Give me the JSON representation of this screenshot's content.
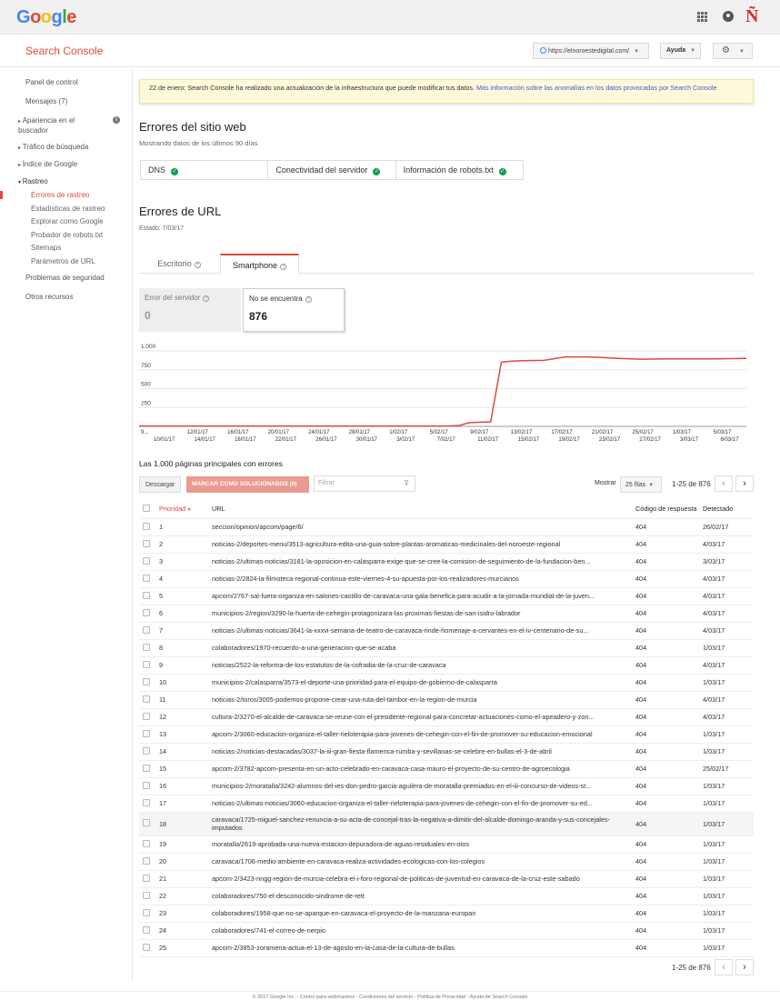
{
  "topbar": {
    "logo": "Google",
    "brand_mark": "Ñ"
  },
  "header": {
    "title": "Search Console",
    "site": "https://elnoroestedigital.com/",
    "help": "Ayuda"
  },
  "sidebar": {
    "panel": "Panel de control",
    "messages": "Mensajes (7)",
    "appearance": "Apariencia en el buscador",
    "traffic": "Tráfico de búsqueda",
    "index": "Índice de Google",
    "crawl": "Rastreo",
    "crawl_items": [
      "Errores de rastreo",
      "Estadísticas de rastreo",
      "Explorar como Google",
      "Probador de robots.txt",
      "Sitemaps",
      "Parámetros de URL"
    ],
    "security": "Problemas de seguridad",
    "other": "Otros recursos"
  },
  "notice": {
    "text": "22 de enero: Search Console ha realizado una actualización de la infraestructura que puede modificar tus datos. ",
    "link": "Más información sobre las anomalías en los datos provocadas por Search Console"
  },
  "site_errors": {
    "title": "Errores del sitio web",
    "subtitle": "Mostrando datos de los últimos 90 días",
    "items": [
      "DNS",
      "Conectividad del servidor",
      "Información de robots.txt"
    ]
  },
  "url_errors": {
    "title": "Errores de URL",
    "state": "Estado: 7/03/17",
    "tabs": [
      "Escritorio",
      "Smartphone"
    ],
    "stats": [
      {
        "label": "Error del servidor",
        "value": "0"
      },
      {
        "label": "No se encuentra",
        "value": "876"
      }
    ]
  },
  "chart_data": {
    "type": "line",
    "title": "",
    "ylabel": "",
    "xlabel": "",
    "ylim": [
      0,
      1000
    ],
    "yticks": [
      "1.000",
      "750",
      "500",
      "250"
    ],
    "xticks_top": [
      "9...",
      "12/01/17",
      "16/01/17",
      "20/01/17",
      "24/01/17",
      "28/01/17",
      "1/02/17",
      "5/02/17",
      "9/02/17",
      "13/02/17",
      "17/02/17",
      "21/02/17",
      "25/02/17",
      "1/03/17",
      "5/03/17"
    ],
    "xticks_bottom": [
      "10/01/17",
      "14/01/17",
      "18/01/17",
      "22/01/17",
      "26/01/17",
      "30/01/17",
      "3/02/17",
      "7/02/17",
      "11/02/17",
      "15/02/17",
      "19/02/17",
      "23/02/17",
      "27/02/17",
      "3/03/17",
      "6/03/17"
    ],
    "color": "#dd4b39",
    "series": [
      {
        "x": [
          0,
          29,
          30,
          31,
          33,
          34,
          35,
          36,
          38,
          40,
          42,
          43,
          45,
          47,
          50,
          52,
          54,
          57
        ],
        "y": [
          5,
          5,
          10,
          50,
          60,
          850,
          865,
          870,
          875,
          920,
          920,
          915,
          900,
          890,
          895,
          895,
          895,
          900
        ]
      }
    ]
  },
  "table_section": {
    "caption": "Las 1.000 páginas principales con errores",
    "download": "Descargar",
    "mark_fixed": "MARCAR COMO SOLUCIONADOS (0)",
    "filter_placeholder": "Filtrar",
    "show": "Mostrar",
    "rows_per_page": "25 filas",
    "range": "1-25 de 876",
    "columns": [
      "Prioridad",
      "URL",
      "Código de respuesta",
      "Detectado"
    ]
  },
  "rows": [
    [
      "1",
      "seccion/opinion/apcom/page/6/",
      "404",
      "26/02/17"
    ],
    [
      "2",
      "noticias-2/deportes-menu/3513-agricultura-edita-una-guia-sobre-plantas-aromaticas-medicinales-del-noroeste-regional",
      "404",
      "4/03/17"
    ],
    [
      "3",
      "noticias-2/ultimas-noticias/3181-la-oposicion-en-calasparra-exige-que-se-cree-la-comision-de-seguimiento-de-la-fundacion-ben...",
      "404",
      "3/03/17"
    ],
    [
      "4",
      "noticias-2/2824-la-filmoteca-regional-continua-este-viernes-4-su-apuesta-por-los-realizadores-murcianos",
      "404",
      "4/03/17"
    ],
    [
      "5",
      "apcom/2767-sal-fuera-organiza-en-salones-castillo-de-caravaca-una-gala-benefica-para-acudir-a-la-jornada-mundial-de-la-juven...",
      "404",
      "4/03/17"
    ],
    [
      "6",
      "municipios-2/region/3290-la-huerta-de-cehegin-protagonizara-las-proximas-fiestas-de-san-isidro-labrador",
      "404",
      "4/03/17"
    ],
    [
      "7",
      "noticias-2/ultimas-noticias/3641-la-xxxvi-semana-de-teatro-de-caravaca-rinde-homenaje-a-cervantes-en-el-iv-centenario-de-su...",
      "404",
      "4/03/17"
    ],
    [
      "8",
      "colaboradores/1970-recuerdo-a-una-generacion-que-se-acaba",
      "404",
      "1/03/17"
    ],
    [
      "9",
      "noticias/2522-la-reforma-de-los-estatutos-de-la-cofradia-de-la-cruz-de-caravaca",
      "404",
      "4/03/17"
    ],
    [
      "10",
      "municipios-2/calasparra/3573-el-deporte-una-prioridad-para-el-equipo-de-gobierno-de-calasparra",
      "404",
      "1/03/17"
    ],
    [
      "11",
      "noticias-2/toros/3005-podemos-propone-crear-una-ruta-del-tambor-en-la-region-de-murcia",
      "404",
      "4/03/17"
    ],
    [
      "12",
      "cultura-2/3270-el-alcalde-de-caravaca-se-reune-con-el-presidente-regional-para-concretar-actuaciones-como-el-apeadero-y-zon...",
      "404",
      "4/03/17"
    ],
    [
      "13",
      "apcom-2/3060-educacion-organiza-el-taller-rieloterapia-para-jovenes-de-cehegin-con-el-fin-de-promover-su-educacion-emocional",
      "404",
      "1/03/17"
    ],
    [
      "14",
      "noticias-2/noticias-destacadas/3037-la-iii-gran-fiesta-flamenca-rumba-y-sevillanas-se-celebre-en-bullas-el-3-de-abril",
      "404",
      "1/03/17"
    ],
    [
      "15",
      "apcom-2/3782-apcom-presenta-en-un-acto-celebrado-en-caravaca-casa-mauro-el-proyecto-de-su-centro-de-agroecologia",
      "404",
      "25/02/17"
    ],
    [
      "16",
      "municipios-2/moratalla/3242-alumnos-del-ies-don-pedro-garcia-aguilera-de-moratalla-premiados-en-el-iii-concurso-de-videos-st...",
      "404",
      "1/03/17"
    ],
    [
      "17",
      "noticias-2/ultimas-noticias/3060-educacion-organiza-el-taller-rieloterapia-para-jovenes-de-cehegin-con-el-fin-de-promover-su-ed...",
      "404",
      "1/03/17"
    ],
    [
      "18",
      "caravaca/1725-miguel-sanchez-renuncia-a-su-acta-de-concejal-tras-la-negativa-a-dimitir-del-alcalde-domingo-aranda-y-sus-concejales-imputados",
      "404",
      "1/03/17"
    ],
    [
      "19",
      "moratalla/2619-aprobada-una-nueva-estacion-depuradora-de-aguas-residuales-en-otos",
      "404",
      "1/03/17"
    ],
    [
      "20",
      "caravaca/1706-medio-ambiente-en-caravaca-realiza-actividades-ecologicas-con-los-colegios",
      "404",
      "1/03/17"
    ],
    [
      "21",
      "apcom-2/3423-nngg-region-de-murcia-celebra-el-i-foro-regional-de-politicas-de-juventud-en-caravaca-de-la-cruz-este-sabado",
      "404",
      "1/03/17"
    ],
    [
      "22",
      "colaboradores/750-el-desconocido-sindrome-de-rett",
      "404",
      "1/03/17"
    ],
    [
      "23",
      "colaboradores/1958-que-no-se-aparque-en-caravaca-el-proyecto-de-la-manzana-europan",
      "404",
      "1/03/17"
    ],
    [
      "24",
      "colaboradores/741-el-correo-de-nerpio",
      "404",
      "1/03/17"
    ],
    [
      "25",
      "apcom-2/3853-zoramena-actua-el-13-de-agosto-en-la-casa-de-la-cultura-de-bullas",
      "404",
      "1/03/17"
    ]
  ],
  "footer": "© 2017 Google Inc. - Centro para webmasters - Condiciones del servicio - Política de Privacidad - Ayuda de Search Console"
}
